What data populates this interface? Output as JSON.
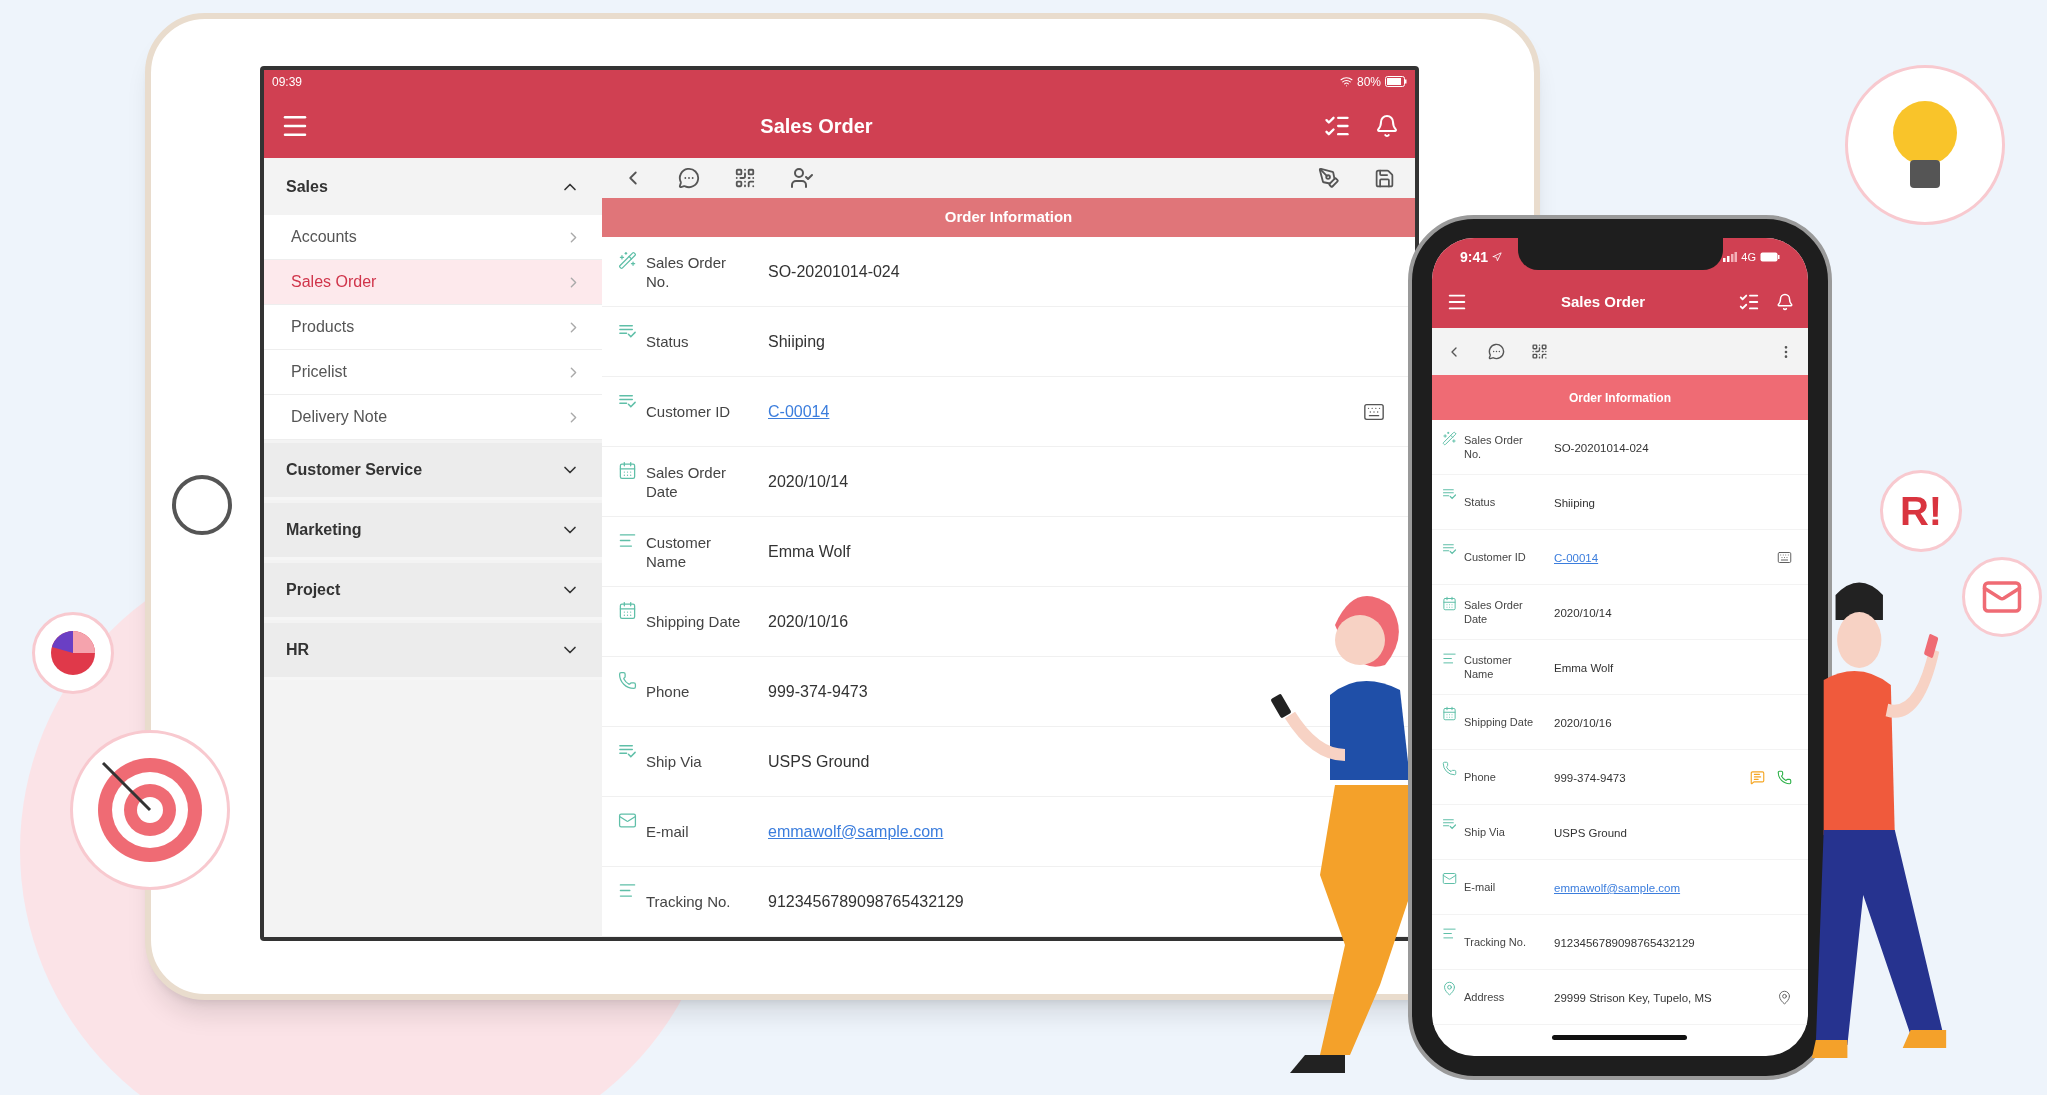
{
  "tablet": {
    "status_bar": {
      "time": "09:39",
      "battery": "80%"
    },
    "header": {
      "title": "Sales Order"
    },
    "sidebar": [
      {
        "label": "Sales",
        "expanded": true,
        "items": [
          {
            "label": "Accounts",
            "selected": false
          },
          {
            "label": "Sales Order",
            "selected": true
          },
          {
            "label": "Products",
            "selected": false
          },
          {
            "label": "Pricelist",
            "selected": false
          },
          {
            "label": "Delivery Note",
            "selected": false
          }
        ]
      },
      {
        "label": "Customer Service",
        "expanded": false
      },
      {
        "label": "Marketing",
        "expanded": false
      },
      {
        "label": "Project",
        "expanded": false
      },
      {
        "label": "HR",
        "expanded": false
      }
    ],
    "section_title": "Order Information",
    "fields": [
      {
        "kind": "id",
        "label": "Sales Order No.",
        "value": "SO-20201014-024"
      },
      {
        "kind": "status",
        "label": "Status",
        "value": "Shiiping"
      },
      {
        "kind": "lookup",
        "label": "Customer ID",
        "value": "C-00014"
      },
      {
        "kind": "date",
        "label": "Sales Order Date",
        "value": "2020/10/14"
      },
      {
        "kind": "name",
        "label": "Customer Name",
        "value": "Emma Wolf"
      },
      {
        "kind": "date",
        "label": "Shipping Date",
        "value": "2020/10/16"
      },
      {
        "kind": "phone",
        "label": "Phone",
        "value": "999-374-9473"
      },
      {
        "kind": "status",
        "label": "Ship Via",
        "value": "USPS Ground"
      },
      {
        "kind": "email",
        "label": "E-mail",
        "value": "emmawolf@sample.com"
      },
      {
        "kind": "name",
        "label": "Tracking No.",
        "value": "9123456789098765432129"
      }
    ]
  },
  "phone": {
    "status_bar": {
      "time": "9:41",
      "network": "4G"
    },
    "header": {
      "title": "Sales Order"
    },
    "section_title": "Order Information",
    "fields": [
      {
        "kind": "id",
        "label": "Sales Order No.",
        "value": "SO-20201014-024"
      },
      {
        "kind": "status",
        "label": "Status",
        "value": "Shiiping"
      },
      {
        "kind": "lookup",
        "label": "Customer ID",
        "value": "C-00014"
      },
      {
        "kind": "date",
        "label": "Sales Order Date",
        "value": "2020/10/14"
      },
      {
        "kind": "name",
        "label": "Customer Name",
        "value": "Emma Wolf"
      },
      {
        "kind": "date",
        "label": "Shipping Date",
        "value": "2020/10/16"
      },
      {
        "kind": "phone",
        "label": "Phone",
        "value": "999-374-9473"
      },
      {
        "kind": "status",
        "label": "Ship Via",
        "value": "USPS Ground"
      },
      {
        "kind": "email",
        "label": "E-mail",
        "value": "emmawolf@sample.com"
      },
      {
        "kind": "name",
        "label": "Tracking No.",
        "value": "9123456789098765432129"
      },
      {
        "kind": "address",
        "label": "Address",
        "value": "29999 Strison Key, Tupelo, MS"
      }
    ]
  },
  "badge": "R!"
}
